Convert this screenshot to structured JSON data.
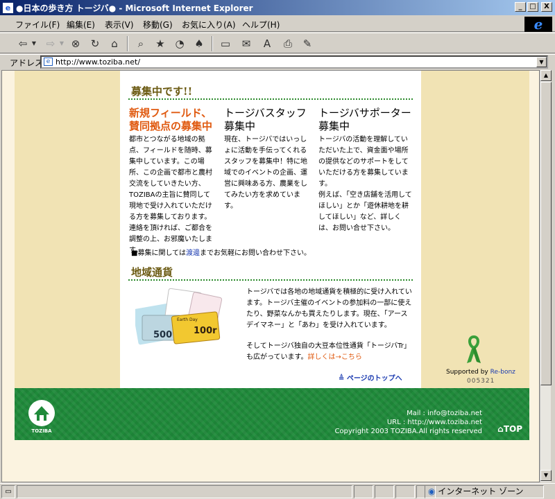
{
  "window": {
    "title": "●日本の歩き方 トージバ● - Microsoft Internet Explorer",
    "buttons": {
      "minimize": "_",
      "maximize": "□",
      "close": "X"
    }
  },
  "menu": [
    "ファイル(F)",
    "編集(E)",
    "表示(V)",
    "移動(G)",
    "お気に入り(A)",
    "ヘルプ(H)"
  ],
  "address": {
    "label": "アドレス",
    "url": "http://www.toziba.net/"
  },
  "recruit": {
    "title": "募集中です!!",
    "columns": [
      {
        "heading": "新規フィールド、賛同拠点の募集中",
        "body": "都市とつながる地域の拠点、フィールドを随時、募集中しています。この場所、この企画で都市と農村交流をしていきたい方、TOZIBAの主旨に賛同して現地で受け入れていただける方を募集しております。連絡を頂ければ、ご都合を調整の上、お邪魔いたします。"
      },
      {
        "heading": "トージバスタッフ募集中",
        "body": "現在、トージバではいっしょに活動を手伝ってくれるスタッフを募集中！特に地域でのイベントの企画、運営に興味ある方、農業をしてみたい方を求めています。"
      },
      {
        "heading": "トージバサポーター募集中",
        "body": "トージバの活動を理解していただいた上で、資金面や場所の提供などのサポートをしていただける方を募集しています。",
        "body2": "例えば、「空き店舗を活用してほしい」とか「遊休耕地を耕してほしい」など、詳しくは、お問い合せ下さい。"
      }
    ],
    "note_pre": "■募集に関しては",
    "note_link": "渡邊",
    "note_post": "までお気軽にお問い合わせ下さい。"
  },
  "currency": {
    "title": "地域通貨",
    "p1": "トージバでは各地の地域通貨を積極的に受け入れています。トージバ主催のイベントの参加料の一部に使えたり、野菜なんかも買えたりします。現在、「アースデイマネー」と「あわ」を受け入れています。",
    "p2": "そしてトージバ独自の大豆本位性通貨「トージバTr」も広がっています。",
    "link": "詳しくは→こちら",
    "note_labels": [
      "500",
      "100r",
      "Earth Day"
    ]
  },
  "pagetop": "ページのトップへ",
  "supported": {
    "pre": "Supported by ",
    "link": "Re-bonz"
  },
  "counter": "005321",
  "footer": {
    "mail": "Mail : info@toziba.net",
    "url": "URL : http://www.toziba.net",
    "copyright": "Copyright 2003 TOZIBA.All rights reserved",
    "top": "TOP",
    "logo": "TOZIBA"
  },
  "status": {
    "zone": "インターネット ゾーン"
  },
  "colors": {
    "green": "#1f8a3a",
    "orange": "#e05a10",
    "beige": "#f1e3b4",
    "olive": "#6b5a12"
  }
}
